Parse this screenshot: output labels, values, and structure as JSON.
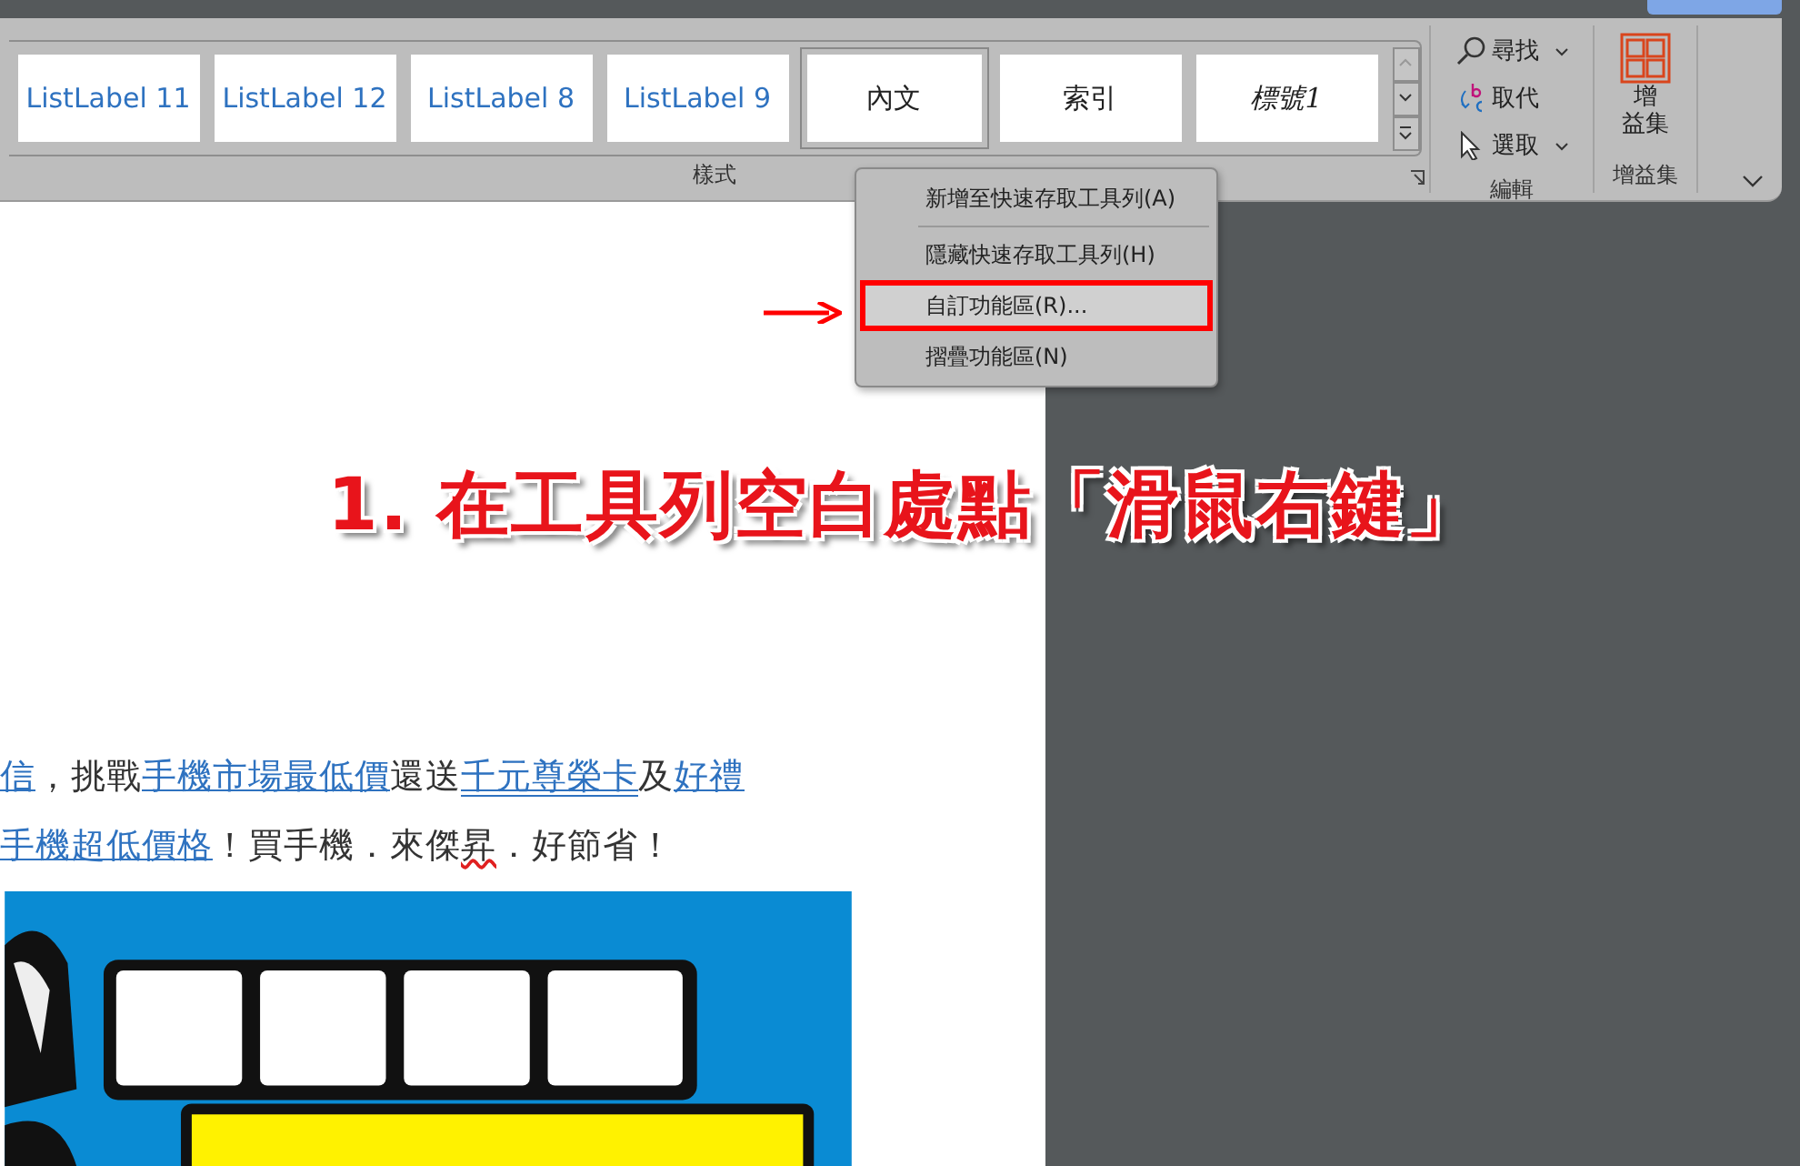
{
  "ribbon": {
    "styles_gallery": [
      {
        "label": "ListLabel 11",
        "kind": "list",
        "selected": false
      },
      {
        "label": "ListLabel 12",
        "kind": "list",
        "selected": false
      },
      {
        "label": "ListLabel 8",
        "kind": "list",
        "selected": false
      },
      {
        "label": "ListLabel 9",
        "kind": "list",
        "selected": false
      },
      {
        "label": "內文",
        "kind": "normal",
        "selected": true
      },
      {
        "label": "索引",
        "kind": "normal",
        "selected": false
      },
      {
        "label": "標號1",
        "kind": "caption",
        "selected": false
      }
    ],
    "styles_group_label": "樣式",
    "editing": [
      {
        "label": "尋找",
        "kind": "find",
        "dropdown": true
      },
      {
        "label": "取代",
        "kind": "replace",
        "dropdown": false
      },
      {
        "label": "選取",
        "kind": "select",
        "dropdown": true
      }
    ],
    "editing_group_label": "編輯",
    "addins_button": [
      "增",
      "益集"
    ],
    "addins_group_label": "增益集"
  },
  "context_menu": [
    {
      "label": "新增至快速存取工具列(A)",
      "selected": false,
      "marked": false,
      "separator_after": true
    },
    {
      "label": "隱藏快速存取工具列(H)",
      "selected": false,
      "marked": false,
      "separator_after": false
    },
    {
      "label": "自訂功能區(R)...",
      "selected": true,
      "marked": true,
      "separator_after": false
    },
    {
      "label": "摺疊功能區(N)",
      "selected": false,
      "marked": false,
      "separator_after": false
    }
  ],
  "annotation": "1. 在工具列空白處點「滑鼠右鍵」",
  "document": {
    "lines": [
      [
        {
          "text": "信",
          "kind": "link"
        },
        {
          "text": "，挑戰",
          "kind": "plain"
        },
        {
          "text": "手機市場最低價",
          "kind": "link"
        },
        {
          "text": "還送",
          "kind": "plain"
        },
        {
          "text": "千元尊榮卡",
          "kind": "double"
        },
        {
          "text": "及",
          "kind": "plain"
        },
        {
          "text": "好禮",
          "kind": "link"
        }
      ],
      [
        {
          "text": "手機超低價格",
          "kind": "link"
        },
        {
          "text": "！買手機．來傑",
          "kind": "plain"
        },
        {
          "text": "昇",
          "kind": "misspelled"
        },
        {
          "text": "．好節省！",
          "kind": "plain"
        }
      ]
    ]
  }
}
